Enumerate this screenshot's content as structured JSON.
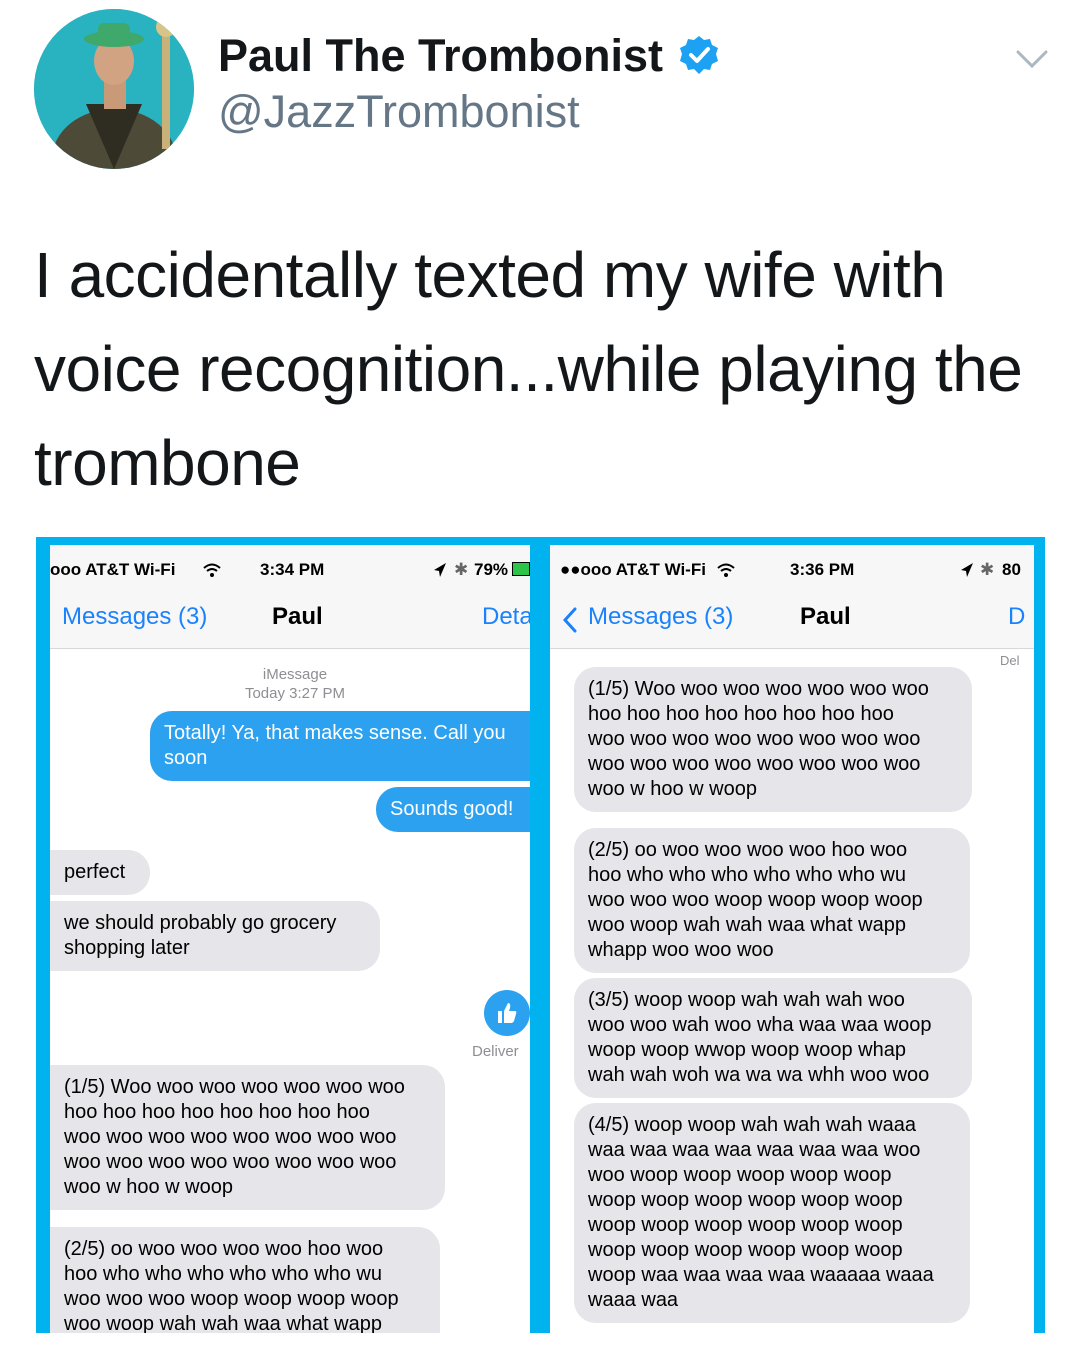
{
  "tweet": {
    "display_name": "Paul The Trombonist",
    "handle": "@JazzTrombonist",
    "text_lines": [
      "I accidentally texted my wife with",
      "voice recognition...while playing the",
      "trombone"
    ]
  },
  "left_phone": {
    "status": {
      "carrier": "ooo AT&T Wi-Fi",
      "time": "3:34 PM",
      "battery": "79%"
    },
    "nav": {
      "back": "Messages (3)",
      "title": "Paul",
      "details": "Deta"
    },
    "meta": {
      "service": "iMessage",
      "timestamp": "Today 3:27 PM"
    },
    "out_1": [
      "Totally! Ya, that makes sense. Call you",
      "soon"
    ],
    "out_2": [
      "Sounds good!"
    ],
    "in_1": [
      "perfect"
    ],
    "in_2": [
      "we should probably go grocery",
      "shopping later"
    ],
    "delivered": "Deliver",
    "in_3": [
      "(1/5) Woo woo woo woo woo woo woo",
      "hoo hoo hoo hoo hoo hoo hoo hoo",
      "woo woo woo woo woo woo woo woo",
      "woo woo woo woo woo woo woo woo",
      "woo w hoo w woop"
    ],
    "in_4": [
      "(2/5) oo woo woo woo woo hoo woo",
      "hoo who who who who who who wu",
      "woo woo woo woop woop woop woop",
      "woo woop wah wah waa what wapp"
    ]
  },
  "right_phone": {
    "status": {
      "carrier": "●●ooo AT&T Wi-Fi",
      "time": "3:36 PM",
      "battery": "80"
    },
    "nav": {
      "back": "Messages (3)",
      "title": "Paul",
      "details": "D"
    },
    "delivered_corner": "Del",
    "msg_1": [
      "(1/5) Woo woo woo woo woo woo woo",
      "hoo hoo hoo hoo hoo hoo hoo hoo",
      "woo woo woo woo woo woo woo woo",
      "woo woo woo woo woo woo woo woo",
      "woo w hoo w woop"
    ],
    "msg_2": [
      "(2/5) oo woo woo woo woo hoo woo",
      "hoo who who who who who who wu",
      "woo woo woo woop woop woop woop",
      "woo woop wah wah waa what wapp",
      "whapp woo woo woo"
    ],
    "msg_3": [
      "(3/5) woop woop wah wah wah woo",
      "woo woo wah woo wha waa waa woop",
      "woop woop wwop woop woop whap",
      "wah wah woh wa wa wa whh woo woo"
    ],
    "msg_4": [
      "(4/5) woop woop wah wah wah waaa",
      "waa waa waa waa waa waa waa woo",
      "woo woop woop woop woop woop",
      "woop woop woop woop woop woop",
      "woop woop woop woop woop woop",
      "woop woop woop woop woop woop",
      "woop waa waa waa waa waaaaa waaa",
      "waaa waa"
    ]
  },
  "colors": {
    "frame": "#00b2ee",
    "ios_blue": "#1a82fb",
    "bubble_out": "#2ba1f0",
    "bubble_in": "#e5e5ea",
    "verified": "#1da1f2"
  }
}
